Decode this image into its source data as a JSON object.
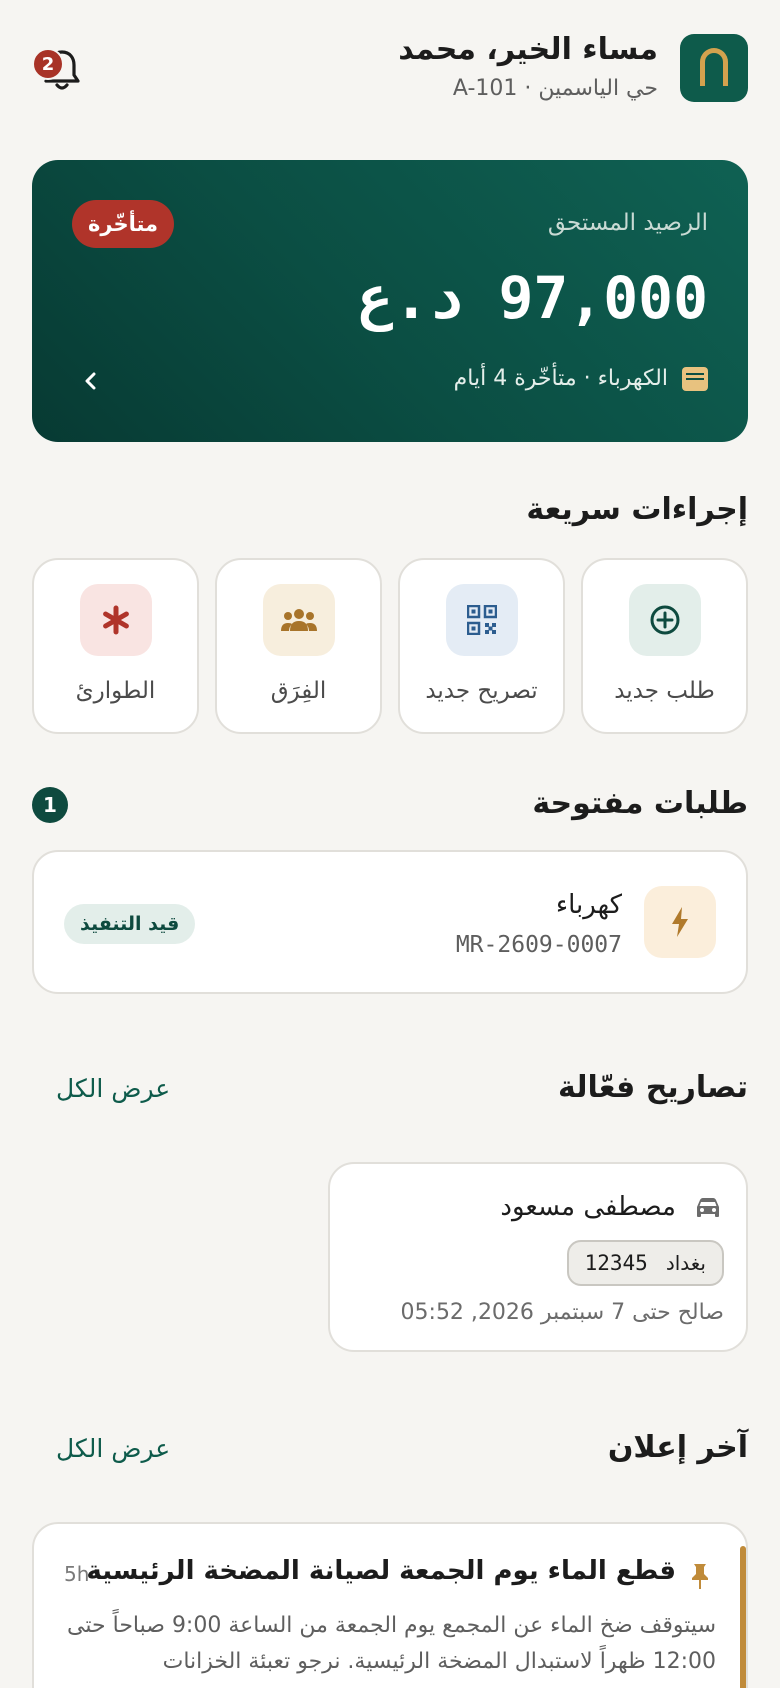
{
  "header": {
    "greeting": "مساء الخير، محمد",
    "location": "حي الياسمين · A-101",
    "notifications_count": "2"
  },
  "balance": {
    "label": "الرصيد المستحق",
    "amount": "97,000 د.ع",
    "status": "متأخّرة",
    "detail": "الكهرباء · متأخّرة 4 أيام"
  },
  "quick_actions": {
    "title": "إجراءات سريعة",
    "items": [
      {
        "label": "طلب جديد",
        "icon": "plus-circle-icon"
      },
      {
        "label": "تصريح جديد",
        "icon": "qr-code-icon"
      },
      {
        "label": "الفِرَق",
        "icon": "team-icon"
      },
      {
        "label": "الطوارئ",
        "icon": "asterisk-icon"
      }
    ]
  },
  "open_requests": {
    "title": "طلبات مفتوحة",
    "count": "1",
    "items": [
      {
        "title": "كهرباء",
        "code": "MR-2609-0007",
        "status": "قيد التنفيذ",
        "icon": "lightning-icon"
      }
    ]
  },
  "permits": {
    "title": "تصاريح فعّالة",
    "view_all": "عرض الكل",
    "items": [
      {
        "name": "مصطفى مسعود",
        "plate_city": "بغداد",
        "plate_number": "12345",
        "valid_until": "صالح حتى 7 سبتمبر 2026, 05:52"
      }
    ]
  },
  "announcements": {
    "title": "آخر إعلان",
    "view_all": "عرض الكل",
    "latest": {
      "title": "قطع الماء يوم الجمعة لصيانة المضخة الرئيسية",
      "time": "5h",
      "body": "سيتوقف ضخ الماء عن المجمع يوم الجمعة من الساعة 9:00 صباحاً حتى 12:00 ظهراً لاستبدال المضخة الرئيسية. نرجو تعبئة الخزانات"
    }
  },
  "colors": {
    "primary": "#0E5B4B",
    "accent": "#C08B3A",
    "danger": "#B0342A",
    "background": "#F6F5F2"
  }
}
